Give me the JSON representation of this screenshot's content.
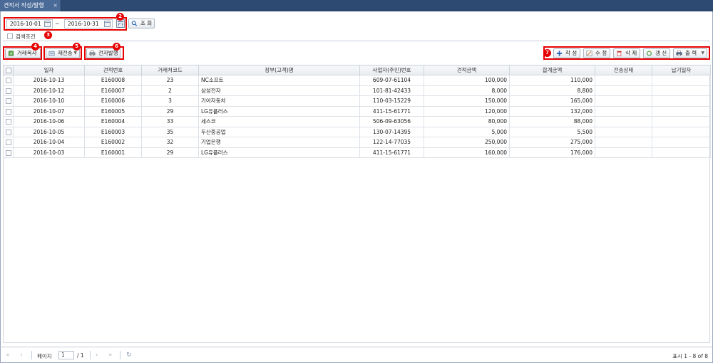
{
  "tab": {
    "title": "견적서 작성/발행",
    "close": "×"
  },
  "search": {
    "date_from": "2016-10-01",
    "tilde": "~",
    "date_to": "2016-10-31",
    "search_label": "조 회",
    "condition_label": "검색조건"
  },
  "toolbar_left": {
    "copy_label": "거래복사",
    "resend_label": "재전송",
    "issue_label": "전자발행"
  },
  "toolbar_right": {
    "create_label": "작 성",
    "edit_label": "수 정",
    "delete_label": "삭 제",
    "renew_label": "갱 신",
    "print_label": "출 력"
  },
  "badges": [
    "2",
    "3",
    "4",
    "5",
    "6",
    "7"
  ],
  "table": {
    "headers": [
      "일자",
      "견적번호",
      "거래처코드",
      "장부(고객)명",
      "사업자(주민)번호",
      "견적금액",
      "합계금액",
      "전송상태",
      "납기일자"
    ],
    "rows": [
      [
        "2016-10-13",
        "E160008",
        "23",
        "NC소프트",
        "609-07-61104",
        "100,000",
        "110,000",
        "",
        ""
      ],
      [
        "2016-10-12",
        "E160007",
        "2",
        "삼성전자",
        "101-81-42433",
        "8,000",
        "8,800",
        "",
        ""
      ],
      [
        "2016-10-10",
        "E160006",
        "3",
        "기아자동차",
        "110-03-15229",
        "150,000",
        "165,000",
        "",
        ""
      ],
      [
        "2016-10-07",
        "E160005",
        "29",
        "LG유플러스",
        "411-15-61771",
        "120,000",
        "132,000",
        "",
        ""
      ],
      [
        "2016-10-06",
        "E160004",
        "33",
        "세스코",
        "506-09-63056",
        "80,000",
        "88,000",
        "",
        ""
      ],
      [
        "2016-10-05",
        "E160003",
        "35",
        "두산중공업",
        "130-07-14395",
        "5,000",
        "5,500",
        "",
        ""
      ],
      [
        "2016-10-04",
        "E160002",
        "32",
        "기업은행",
        "122-14-77035",
        "250,000",
        "275,000",
        "",
        ""
      ],
      [
        "2016-10-03",
        "E160001",
        "29",
        "LG유플러스",
        "411-15-61771",
        "160,000",
        "176,000",
        "",
        ""
      ]
    ]
  },
  "pager": {
    "page_label": "페이지",
    "current_page": "1",
    "total_pages": "/ 1",
    "summary": "표시 1 - 8 of 8",
    "first": "«",
    "prev": "‹",
    "next": "›",
    "last": "»",
    "refresh": "↻"
  },
  "colors": {
    "header_bar": "#2d4a73",
    "highlight": "#e60000"
  }
}
